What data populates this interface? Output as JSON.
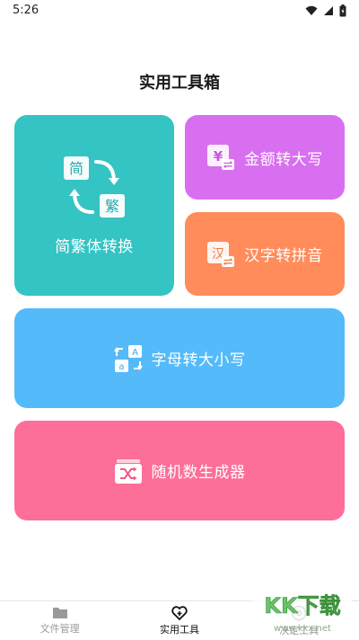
{
  "status_bar": {
    "time": "5:26",
    "icons": [
      "wifi-icon",
      "signal-icon",
      "battery-icon"
    ]
  },
  "page": {
    "title": "实用工具箱"
  },
  "tiles": {
    "convert": {
      "label": "简繁体转换",
      "icon_simplified": "简",
      "icon_traditional": "繁",
      "color": "#35c4c4"
    },
    "money": {
      "label": "金额转大写",
      "icon": "yen-icon",
      "color": "#d86ff0"
    },
    "pinyin": {
      "label": "汉字转拼音",
      "icon_char": "汉",
      "color": "#ff8c5a"
    },
    "letter_case": {
      "label": "字母转大小写",
      "icon_upper": "A",
      "icon_lower": "a",
      "color": "#55baf9"
    },
    "random": {
      "label": "随机数生成器",
      "icon": "shuffle-icon",
      "color": "#fd6e98"
    }
  },
  "tabbar": {
    "items": [
      {
        "label": "文件管理",
        "icon": "folder-icon",
        "active": false
      },
      {
        "label": "实用工具",
        "icon": "heart-plus-icon",
        "active": true
      },
      {
        "label": "决定工具",
        "icon": "target-icon",
        "active": false
      }
    ]
  },
  "watermark": {
    "text": "KK下载",
    "url": "www.kkx.net"
  }
}
